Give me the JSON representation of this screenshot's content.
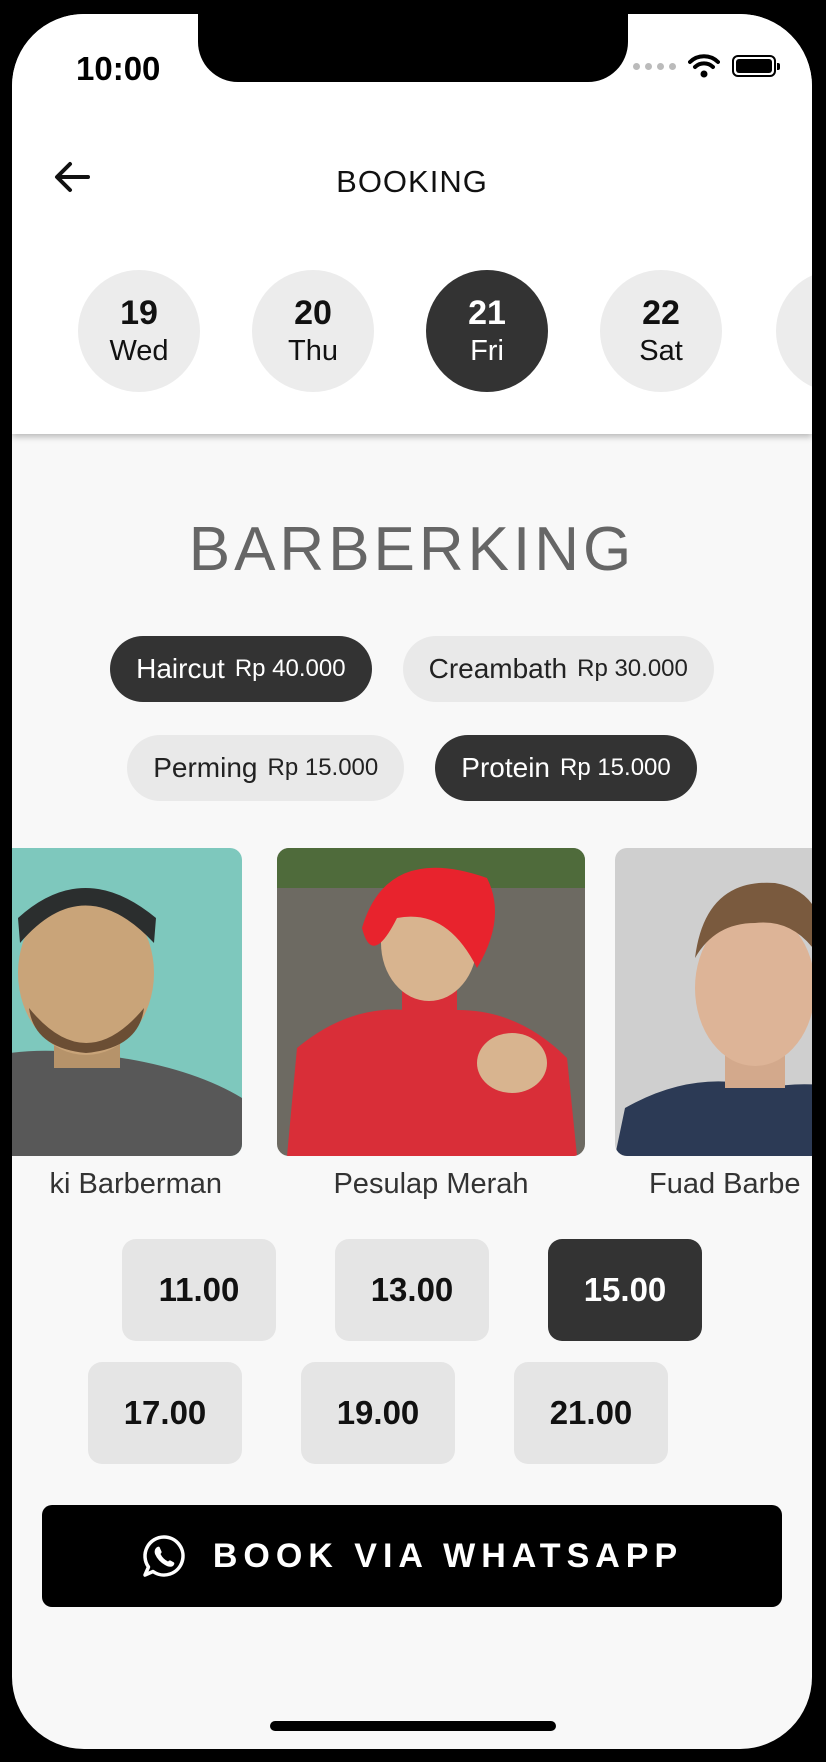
{
  "status_bar": {
    "time": "10:00"
  },
  "header": {
    "title": "BOOKING"
  },
  "dates": [
    {
      "day": "19",
      "weekday": "Wed",
      "selected": false
    },
    {
      "day": "20",
      "weekday": "Thu",
      "selected": false
    },
    {
      "day": "21",
      "weekday": "Fri",
      "selected": true
    },
    {
      "day": "22",
      "weekday": "Sat",
      "selected": false
    }
  ],
  "shop_name": "BARBERKING",
  "services": [
    {
      "name": "Haircut",
      "price": "Rp 40.000",
      "selected": true
    },
    {
      "name": "Creambath",
      "price": "Rp 30.000",
      "selected": false
    },
    {
      "name": "Perming",
      "price": "Rp 15.000",
      "selected": false
    },
    {
      "name": "Protein",
      "price": "Rp 15.000",
      "selected": true
    }
  ],
  "barbers": [
    {
      "name": "ki Barberman"
    },
    {
      "name": "Pesulap Merah"
    },
    {
      "name": "Fuad Barbe"
    }
  ],
  "times": [
    {
      "label": "11.00",
      "selected": false
    },
    {
      "label": "13.00",
      "selected": false
    },
    {
      "label": "15.00",
      "selected": true
    },
    {
      "label": "17.00",
      "selected": false
    },
    {
      "label": "19.00",
      "selected": false
    },
    {
      "label": "21.00",
      "selected": false
    }
  ],
  "book_button": {
    "label": "BOOK VIA WHATSAPP",
    "icon": "whatsapp-icon"
  },
  "colors": {
    "selected": "#333333",
    "unselected": "#e9e9e9",
    "cta": "#000000"
  }
}
